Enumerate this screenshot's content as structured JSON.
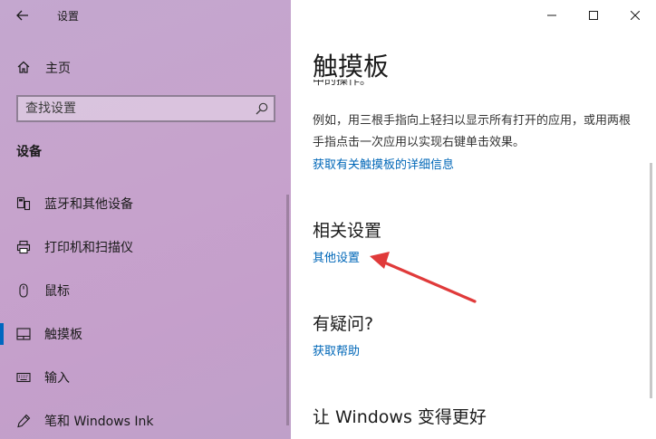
{
  "window": {
    "title": "设置",
    "controls": [
      "minimize",
      "maximize",
      "close"
    ]
  },
  "sidebar": {
    "home_label": "主页",
    "search_placeholder": "查找设置",
    "section_title": "设备",
    "items": [
      {
        "label": "蓝牙和其他设备",
        "icon": "bluetooth-devices-icon"
      },
      {
        "label": "打印机和扫描仪",
        "icon": "printer-icon"
      },
      {
        "label": "鼠标",
        "icon": "mouse-icon"
      },
      {
        "label": "触摸板",
        "icon": "touchpad-icon",
        "active": true
      },
      {
        "label": "输入",
        "icon": "keyboard-icon"
      },
      {
        "label": "笔和 Windows Ink",
        "icon": "pen-icon"
      }
    ]
  },
  "main": {
    "title": "触摸板",
    "clipped_text": "中的操作。",
    "description": "例如，用三根手指向上轻扫以显示所有打开的应用，或用两根手指点击一次应用以实现右键单击效果。",
    "details_link": "获取有关触摸板的详细信息",
    "related_heading": "相关设置",
    "other_settings_link": "其他设置",
    "question_heading": "有疑问?",
    "help_link": "获取帮助",
    "improve_heading": "让 Windows 变得更好"
  },
  "colors": {
    "accent": "#0067c0",
    "link": "#0067b8",
    "arrow": "#e03a3a"
  }
}
